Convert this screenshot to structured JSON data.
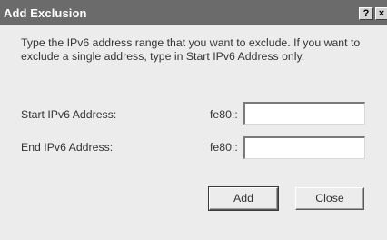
{
  "window": {
    "title": "Add Exclusion",
    "help_label": "?",
    "close_label": "×"
  },
  "description": "Type the IPv6 address range that you want to exclude. If you want to exclude a single address, type in Start IPv6 Address only.",
  "start": {
    "label": "Start IPv6 Address:",
    "prefix": "fe80::",
    "value": ""
  },
  "end": {
    "label": "End IPv6 Address:",
    "prefix": "fe80::",
    "value": ""
  },
  "buttons": {
    "add": "Add",
    "close": "Close"
  }
}
